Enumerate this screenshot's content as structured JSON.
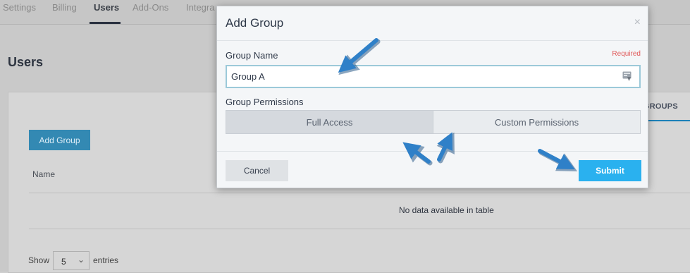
{
  "topnav": {
    "tabs": [
      {
        "label": "Settings"
      },
      {
        "label": "Billing"
      },
      {
        "label": "Users"
      },
      {
        "label": "Add-Ons"
      },
      {
        "label": "Integra"
      }
    ]
  },
  "page": {
    "title": "Users",
    "groups_tab": "GROUPS",
    "add_group_label": "Add Group",
    "table": {
      "columns": [
        "Name"
      ],
      "empty_text": "No data available in table"
    },
    "pagination": {
      "show_label": "Show",
      "page_size": "5",
      "entries_label": "entries"
    }
  },
  "modal": {
    "title": "Add Group",
    "close_glyph": "×",
    "group_name_label": "Group Name",
    "required_label": "Required",
    "group_name_value": "Group A",
    "permissions_label": "Group Permissions",
    "permission_options": [
      "Full Access",
      "Custom Permissions"
    ],
    "cancel_label": "Cancel",
    "submit_label": "Submit"
  },
  "colors": {
    "submit": "#2ab1ef",
    "required": "#e05a5a",
    "annotation_arrow": "#2f80c8"
  },
  "icons": [
    "close-icon",
    "input-autofill-icon",
    "chevron-down-icon",
    "annotation-arrow"
  ]
}
